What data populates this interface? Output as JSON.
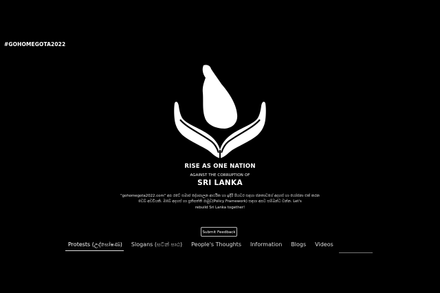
{
  "brand": "#GOHOMEGOTA2022",
  "hero": {
    "line1": "RISE AS ONE NATION",
    "line2": "AGAINST THE CORRUPTION OF",
    "line3": "SRI LANKA"
  },
  "description": {
    "main": "\"gohomegota2022.com\" අප රටේ සමාජ දේශපාලන ආර්ථික හා ඉදිරි පියවර සඳහා ජනතාවගේ අදහස් හා යෝජනා එක් කරන වෙබ් අඩවියකි. ඔබේ අදහස් හා ප්‍රතිපත්ති රාමුව(Policy Framework) සඳහා අපට සම්බන්ධ වන්න. Let's",
    "tail": "rebuild Sri Lanka together!"
  },
  "feedback_button": "Submit Feedback",
  "tabs": [
    {
      "label": "Protests (උද්ඝෝෂණ)",
      "active": true
    },
    {
      "label": "Slogans (සටන් පාඨ)",
      "active": false
    },
    {
      "label": "People's Thoughts",
      "active": false
    },
    {
      "label": "Information",
      "active": false
    },
    {
      "label": "Blogs",
      "active": false
    },
    {
      "label": "Videos",
      "active": false
    }
  ],
  "icons": {
    "logo": "hands-holding-sri-lanka-icon"
  },
  "colors": {
    "background": "#000000",
    "text": "#ffffff"
  }
}
